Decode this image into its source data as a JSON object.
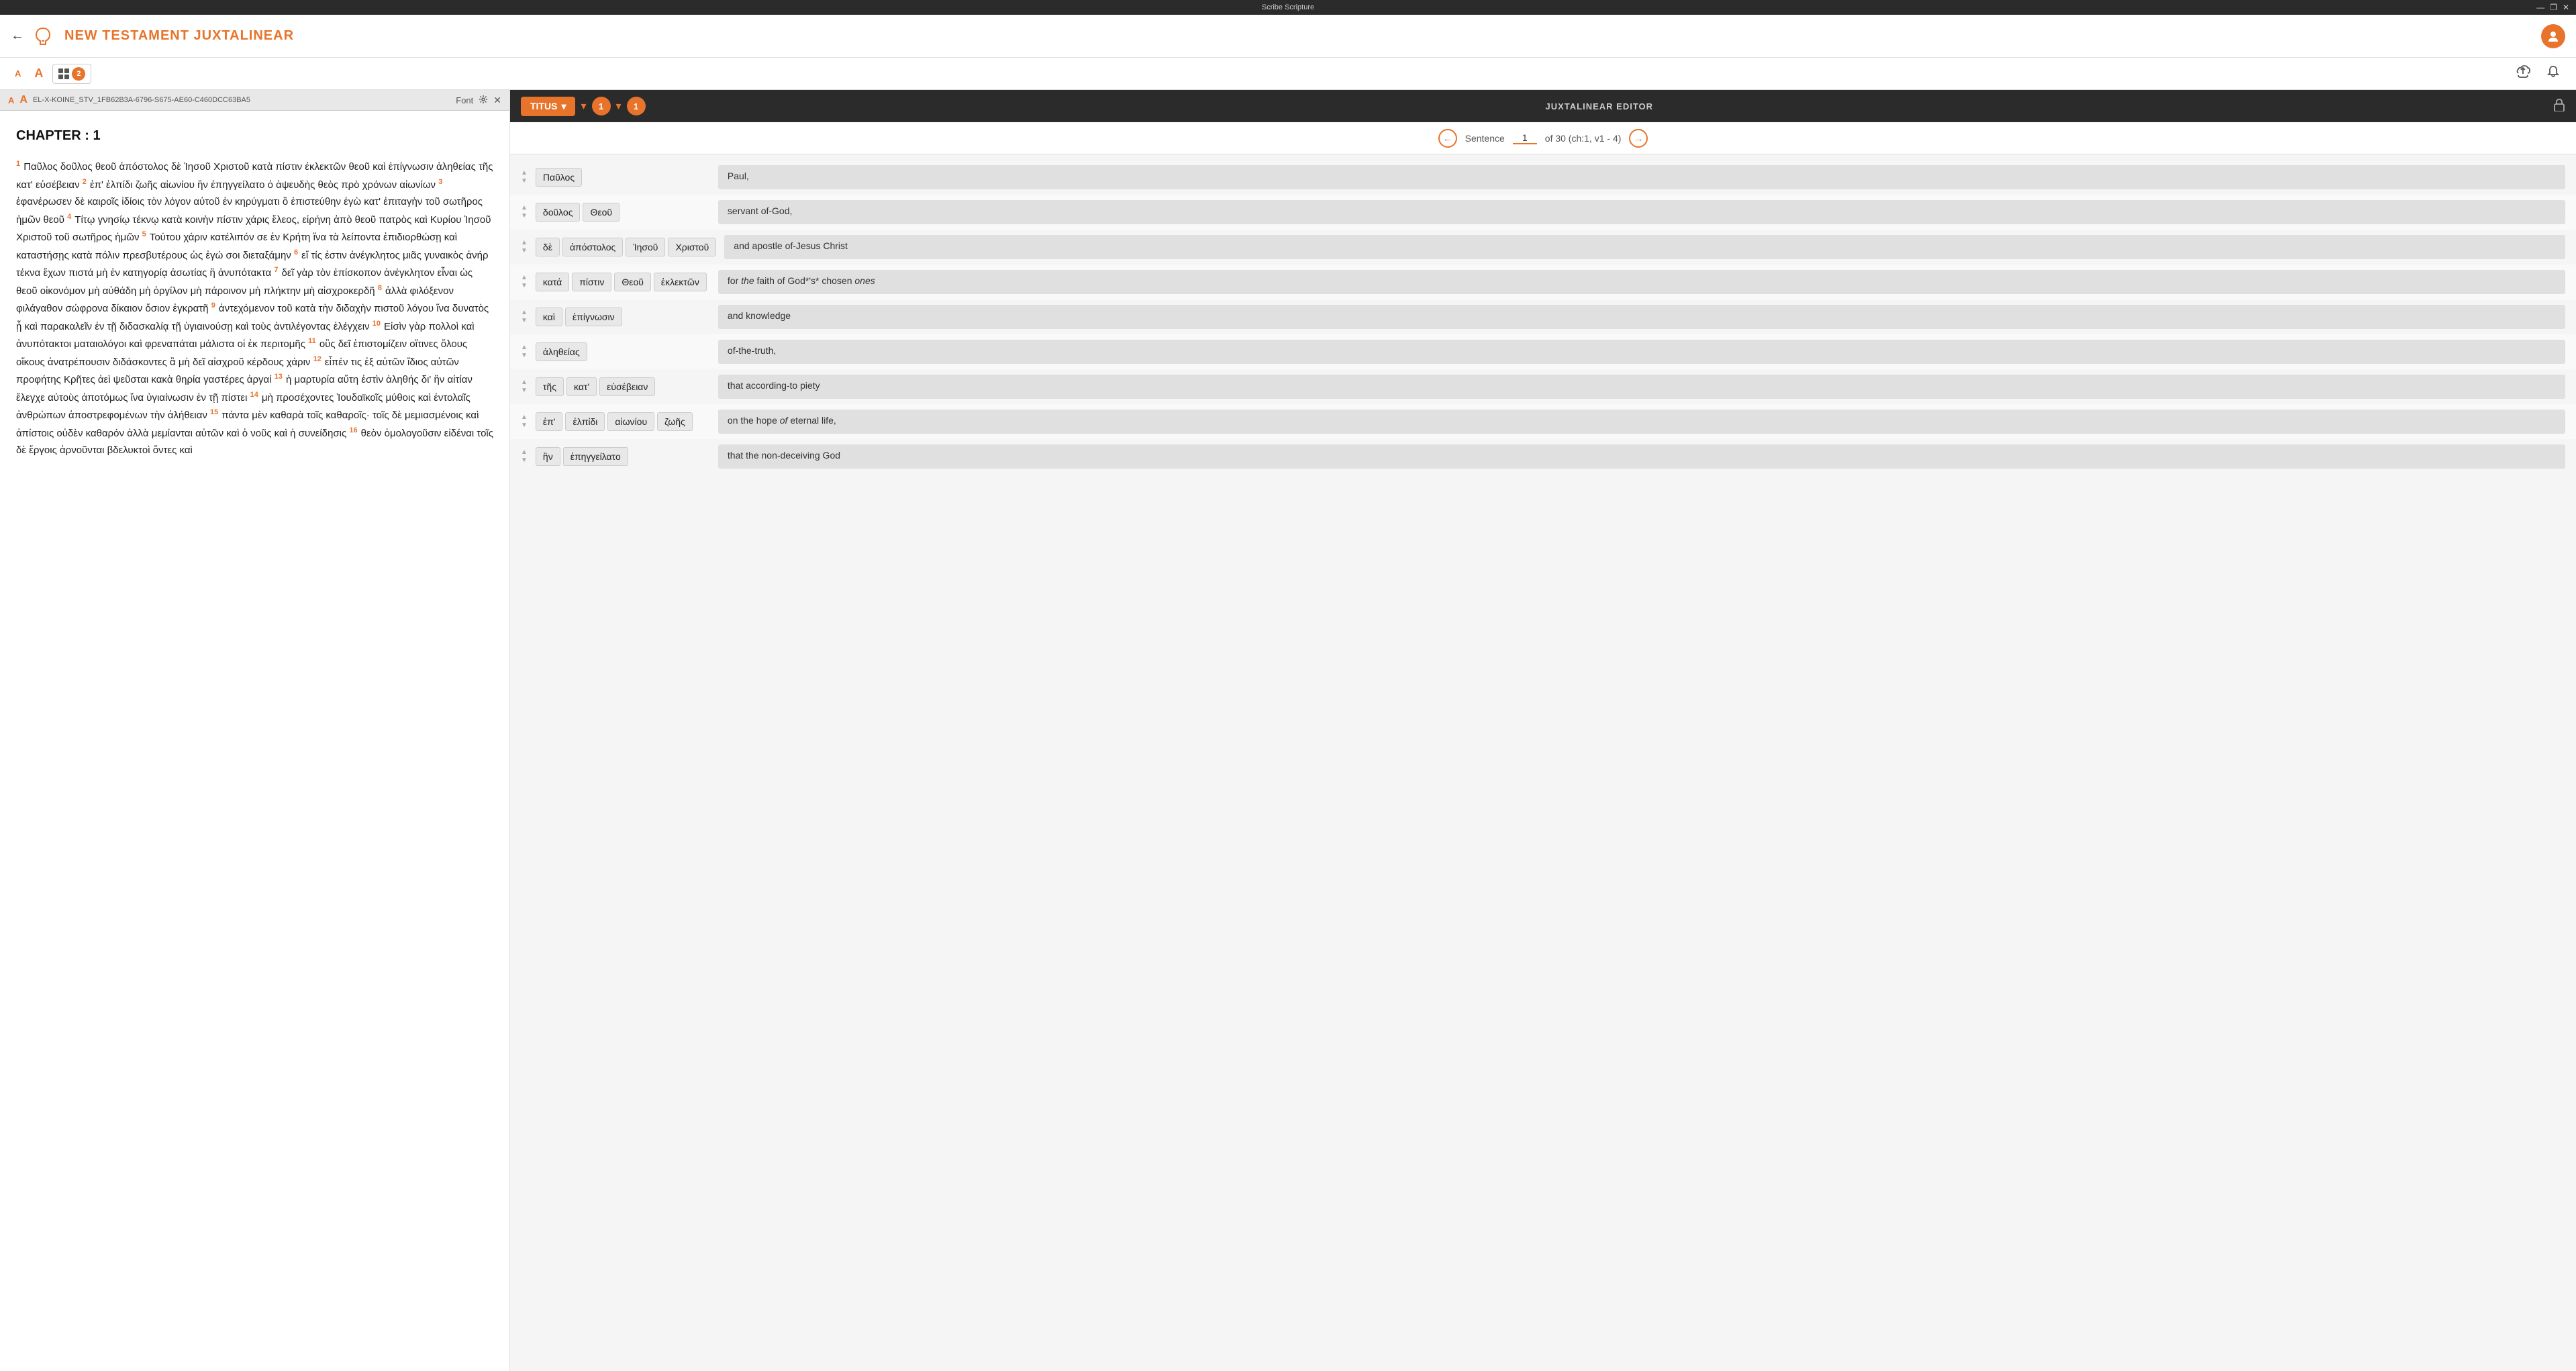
{
  "titleBar": {
    "title": "Scribe Scripture",
    "windowControls": [
      "—",
      "❐",
      "✕"
    ]
  },
  "header": {
    "backLabel": "←",
    "title": "NEW TESTAMENT JUXTALINEAR",
    "userInitial": "👤"
  },
  "toolbar": {
    "fontSmall": "A",
    "fontLarge": "A",
    "viewCount": "2",
    "uploadIcon": "☁",
    "bellIcon": "🔔"
  },
  "leftPanel": {
    "fileName": "EL-X-KOINE_STV_1FB62B3A-6796-S675-AE60-C460DCC63BA5",
    "fontSmall": "A",
    "fontLarge": "A",
    "fontLabel": "Font",
    "settingsIcon": "⚙",
    "closeIcon": "✕",
    "chapterHeading": "CHAPTER : 1",
    "verses": [
      {
        "num": "1",
        "text": "Παῦλος δοῦλος θεοῦ ἀπόστολος δὲ Ἰησοῦ Χριστοῦ κατὰ πίστιν ἐκλεκτῶν θεοῦ καὶ ἐπίγνωσιν ἀληθείας τῆς κατ' εὐσέβειαν "
      },
      {
        "num": "2",
        "text": "ἐπ' ἐλπίδι ζωῆς αἰωνίου ἣν ἐπηγγείλατο ὁ ἀψευδὴς θεὸς πρὸ χρόνων αἰωνίων "
      },
      {
        "num": "3",
        "text": "ἐφανέρωσεν δὲ καιροῖς ἰδίοις τὸν λόγον αὐτοῦ ἐν κηρύγματι ὃ ἐπιστεύθην ἐγὼ κατ' ἐπιταγὴν τοῦ σωτῆρος ἡμῶν θεοῦ "
      },
      {
        "num": "4",
        "text": "Τίτῳ γνησίῳ τέκνῳ κατὰ κοινὴν πίστιν χάρις ἔλεος, εἰρήνη ἀπὸ θεοῦ πατρὸς καὶ Κυρίου Ἰησοῦ Χριστοῦ τοῦ σωτῆρος ἡμῶν "
      },
      {
        "num": "5",
        "text": "Τούτου χάριν κατέλιπόν σε ἐν Κρήτη ἵνα τὰ λείποντα ἐπιδιορθώσῃ καὶ καταστήσῃς κατὰ πόλιν πρεσβυτέρους ὡς ἐγώ σοι διεταξάμην "
      },
      {
        "num": "6",
        "text": "εἴ τίς ἐστιν ἀνέγκλητος μιᾶς γυναικὸς ἀνήρ τέκνα ἔχων πιστά μὴ ἐν κατηγορίᾳ ἀσωτίας ἢ ἀνυπότακτα "
      },
      {
        "num": "7",
        "text": "δεῖ γὰρ τὸν ἐπίσκοπον ἀνέγκλητον εἶναι ὡς θεοῦ οἰκονόμον μὴ αὐθάδη μὴ ὀργίλον μὴ πάροινον μὴ πλήκτην μὴ αἰσχροκερδῆ "
      },
      {
        "num": "8",
        "text": "ἀλλὰ φιλόξενον φιλάγαθον σώφρονα δίκαιον ὅσιον ἐγκρατῆ "
      },
      {
        "num": "9",
        "text": "ἀντεχόμενον τοῦ κατὰ τὴν διδαχὴν πιστοῦ λόγου ἵνα δυνατὸς ᾖ καὶ παρακαλεῖν ἐν τῇ διδασκαλίᾳ τῇ ὑγιαινούσῃ καὶ τοὺς ἀντιλέγοντας ἐλέγχειν "
      },
      {
        "num": "10",
        "text": "Εἰσὶν γὰρ πολλοὶ καὶ ἀνυπότακτοι ματαιολόγοι καὶ φρεναπάται μάλιστα οἱ ἐκ περιτομῆς "
      },
      {
        "num": "11",
        "text": "οὓς δεῖ ἐπιστομίζειν οἵτινες ὅλους οἴκους ἀνατρέπουσιν διδάσκοντες ἃ μὴ δεῖ αἰσχροῦ κέρδους χάριν "
      },
      {
        "num": "12",
        "text": "εἶπέν τις ἐξ αὐτῶν ἴδιος αὐτῶν προφήτης Κρῆτες ἀεὶ ψεῦσται κακὰ θηρία γαστέρες ἀργαί "
      },
      {
        "num": "13",
        "text": "ἡ μαρτυρία αὕτη ἐστὶν ἀληθής δι' ἣν αἰτίαν ἔλεγχε αὐτοὺς ἀποτόμως ἵνα ὑγιαίνωσιν ἐν τῇ πίστει "
      },
      {
        "num": "14",
        "text": "μὴ προσέχοντες Ἰουδαϊκοῖς μύθοις καὶ ἐντολαῖς ἀνθρώπων ἀποστρεφομένων τὴν ἀλήθειαν "
      },
      {
        "num": "15",
        "text": "πάντα μὲν καθαρὰ τοῖς καθαροῖς· τοῖς δὲ μεμιασμένοις καὶ ἀπίστοις οὐδὲν καθαρόν ἀλλὰ μεμίανται αὐτῶν καὶ ὁ νοῦς καὶ ἡ συνείδησις "
      },
      {
        "num": "16",
        "text": "θεὸν ὁμολογοῦσιν εἰδέναι τοῖς δὲ ἔργοις ἀρνοῦνται βδελυκτοὶ ὄντες καὶ"
      }
    ]
  },
  "rightPanel": {
    "titusLabel": "TITUS",
    "chapterNum": "1",
    "verseNum": "1",
    "editorTitle": "JUXTALINEAR EDITOR",
    "lockIcon": "🔒",
    "sentenceLabel": "Sentence",
    "sentenceCurrent": "1",
    "sentenceTotal": "of 30 (ch:1, v1 - 4)",
    "wordRows": [
      {
        "greekWords": [
          "Παῦλος"
        ],
        "gloss": "Paul,"
      },
      {
        "greekWords": [
          "δοῦλος",
          "Θεοῦ"
        ],
        "gloss": "servant of-God,"
      },
      {
        "greekWords": [
          "δὲ",
          "ἀπόστολος",
          "Ἰησοῦ",
          "Χριστοῦ"
        ],
        "gloss": "and apostle of-Jesus Christ"
      },
      {
        "greekWords": [
          "κατά",
          "πίστιν",
          "Θεοῦ",
          "ἐκλεκτῶν"
        ],
        "gloss": "for the faith of God*'s* chosen ones"
      },
      {
        "greekWords": [
          "καὶ",
          "ἐπίγνωσιν"
        ],
        "gloss": "and knowledge"
      },
      {
        "greekWords": [
          "ἀληθείας"
        ],
        "gloss": "of-the-truth,"
      },
      {
        "greekWords": [
          "τῆς",
          "κατ'",
          "εὐσέβειαν"
        ],
        "gloss": "that according-to piety"
      },
      {
        "greekWords": [
          "ἐπ'",
          "ἐλπίδι",
          "αἰωνίου",
          "ζωῆς"
        ],
        "gloss": "on the hope of eternal life,"
      },
      {
        "greekWords": [
          "ἣν",
          "ἐπηγγείλατο"
        ],
        "gloss": "that the non-deceiving God"
      }
    ]
  }
}
